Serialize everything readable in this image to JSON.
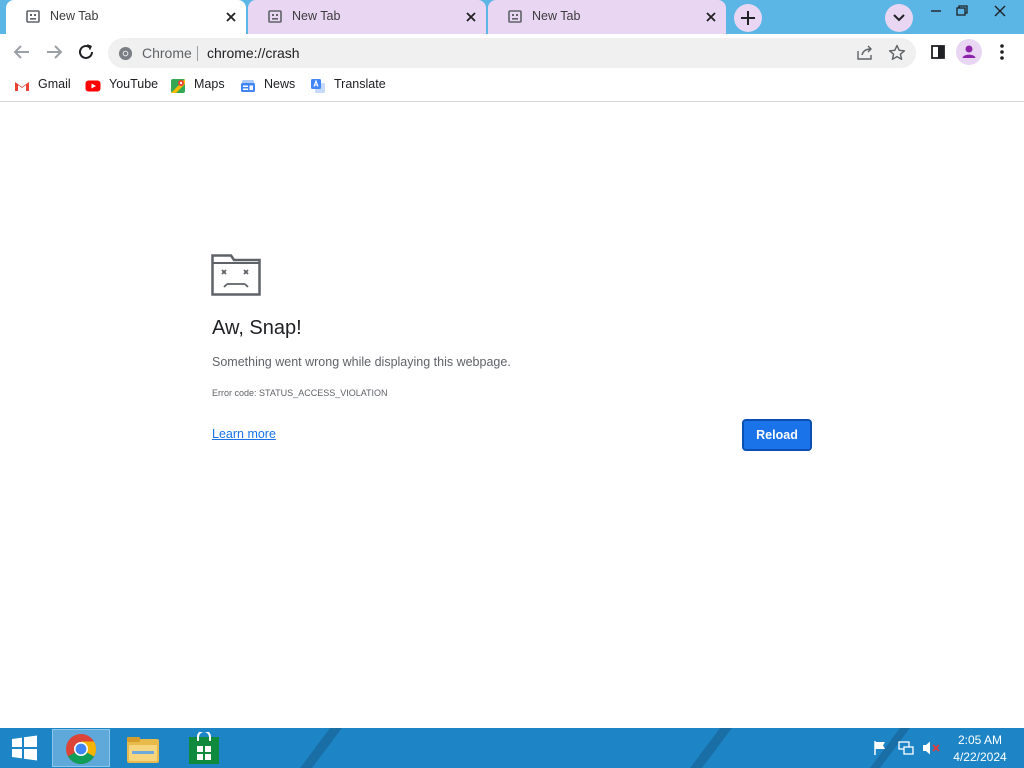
{
  "tabs": [
    {
      "title": "New Tab",
      "active": true
    },
    {
      "title": "New Tab",
      "active": false
    },
    {
      "title": "New Tab",
      "active": false
    }
  ],
  "omnibox": {
    "chip": "Chrome",
    "url": "chrome://crash"
  },
  "bookmarks": [
    {
      "label": "Gmail",
      "icon": "gmail-icon"
    },
    {
      "label": "YouTube",
      "icon": "youtube-icon"
    },
    {
      "label": "Maps",
      "icon": "maps-icon"
    },
    {
      "label": "News",
      "icon": "news-icon"
    },
    {
      "label": "Translate",
      "icon": "translate-icon"
    }
  ],
  "error": {
    "title": "Aw, Snap!",
    "message": "Something went wrong while displaying this webpage.",
    "code": "Error code: STATUS_ACCESS_VIOLATION",
    "learn_more": "Learn more",
    "reload": "Reload"
  },
  "taskbar": {
    "apps": [
      "start-icon",
      "chrome-icon",
      "file-explorer-icon",
      "store-icon"
    ],
    "time": "2:05 AM",
    "date": "4/22/2024"
  },
  "colors": {
    "accent": "#1a73e8",
    "tabstrip": "#5bb5e5",
    "inactive_tab": "#e9d6f3",
    "taskbar": "#1d85c6"
  }
}
